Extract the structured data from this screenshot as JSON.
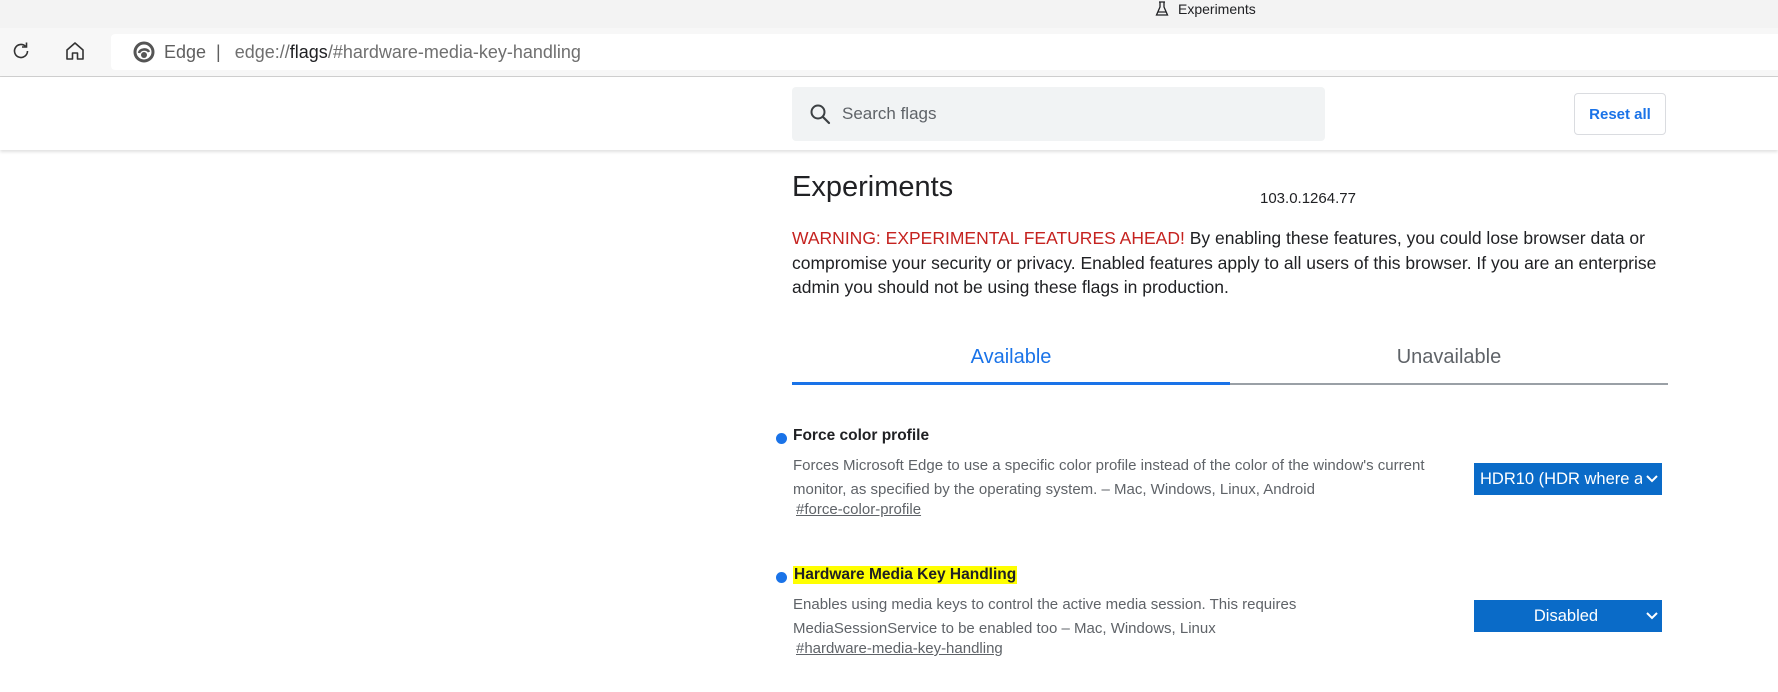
{
  "window": {
    "tab_title": "Experiments",
    "tab_icon": "flask-icon"
  },
  "toolbar": {
    "refresh_icon": "refresh-icon",
    "home_icon": "home-icon",
    "site_name": "Edge",
    "url_scheme": "edge://",
    "url_host": "flags",
    "url_rest": "/#hardware-media-key-handling"
  },
  "flags_header": {
    "search_placeholder": "Search flags",
    "search_value": "",
    "reset_label": "Reset all"
  },
  "main": {
    "title": "Experiments",
    "version": "103.0.1264.77",
    "warning": "WARNING: EXPERIMENTAL FEATURES AHEAD!",
    "blurb": " By enabling these features, you could lose browser data or compromise your security or privacy. Enabled features apply to all users of this browser. If you are an enterprise admin you should not be using these flags in production.",
    "tabs": [
      {
        "label": "Available",
        "active": true
      },
      {
        "label": "Unavailable",
        "active": false
      }
    ]
  },
  "flags": [
    {
      "name": "Force color profile",
      "description": "Forces Microsoft Edge to use a specific color profile instead of the color of the window's current monitor, as specified by the operating system. – Mac, Windows, Linux, Android",
      "link": "#force-color-profile",
      "selected": "HDR10 (HDR where a",
      "highlighted": false
    },
    {
      "name": "Hardware Media Key Handling",
      "description": "Enables using media keys to control the active media session. This requires MediaSessionService to be enabled too – Mac, Windows, Linux",
      "link": "#hardware-media-key-handling",
      "selected": "Disabled",
      "highlighted": true
    }
  ],
  "colors": {
    "accent": "#1a73e8",
    "warning": "#c5221f",
    "select_bg": "#0a6bc8",
    "highlight": "#ffff00"
  }
}
